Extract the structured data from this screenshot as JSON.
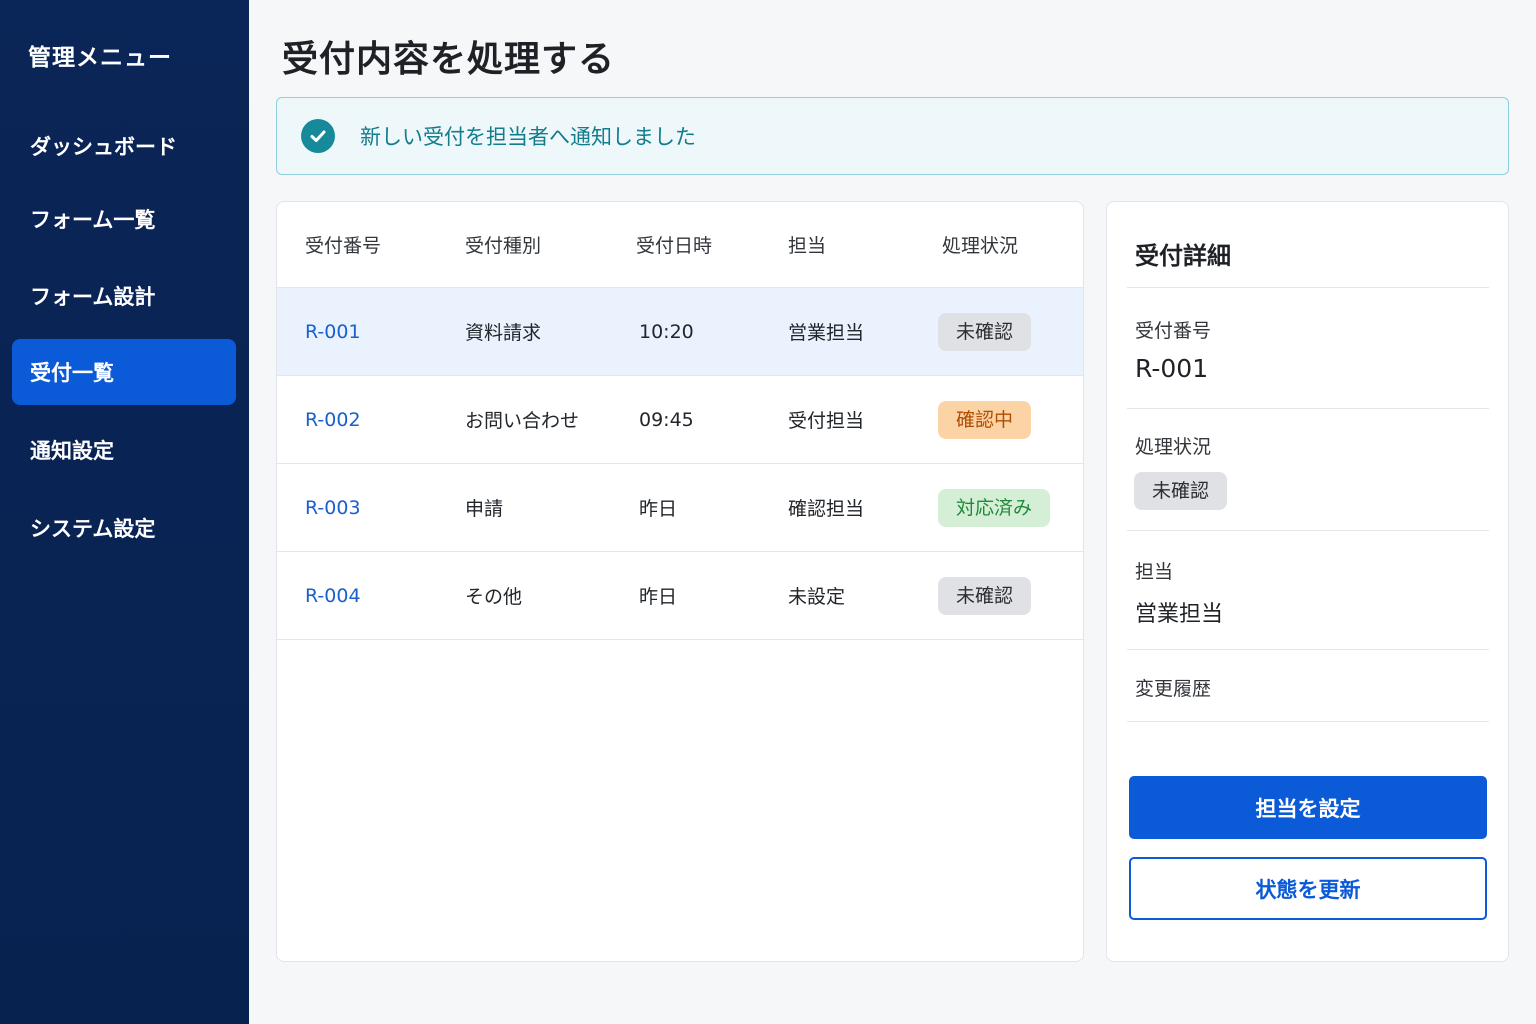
{
  "sidebar": {
    "title": "管理メニュー",
    "items": [
      {
        "label": "ダッシュボード",
        "active": false
      },
      {
        "label": "フォーム一覧",
        "active": false
      },
      {
        "label": "フォーム設計",
        "active": false
      },
      {
        "label": "受付一覧",
        "active": true
      },
      {
        "label": "通知設定",
        "active": false
      },
      {
        "label": "システム設定",
        "active": false
      }
    ]
  },
  "main": {
    "title": "受付内容を処理する",
    "banner": {
      "icon": "check-circle-icon",
      "text": "新しい受付を担当者へ通知しました",
      "color": "#168a9a"
    }
  },
  "table": {
    "headers": [
      "受付番号",
      "受付種別",
      "受付日時",
      "担当",
      "処理状況"
    ],
    "rows": [
      {
        "id": "R-001",
        "type": "資料請求",
        "datetime": "10:20",
        "assignee": "営業担当",
        "status": "未確認",
        "selected": true
      },
      {
        "id": "R-002",
        "type": "お問い合わせ",
        "datetime": "09:45",
        "assignee": "受付担当",
        "status": "確認中"
      },
      {
        "id": "R-003",
        "type": "申請",
        "datetime": "昨日",
        "assignee": "確認担当",
        "status": "対応済み"
      },
      {
        "id": "R-004",
        "type": "その他",
        "datetime": "昨日",
        "assignee": "未設定",
        "status": "未確認"
      }
    ]
  },
  "detail": {
    "title": "受付詳細",
    "id_label": "受付番号",
    "id_value": "R-001",
    "status_label": "処理状況",
    "status_value": "未確認",
    "assignee_label": "担当",
    "assignee_value": "営業担当",
    "history_label": "変更履歴",
    "assign_button": "担当を設定",
    "update_button": "状態を更新"
  },
  "colors": {
    "sidebar_bg": "#0a2557",
    "accent": "#0b5ad8",
    "status_unconfirmed": "#dfe1e4",
    "status_in_progress": "#fcd3a5",
    "status_done": "#d4efd6"
  }
}
